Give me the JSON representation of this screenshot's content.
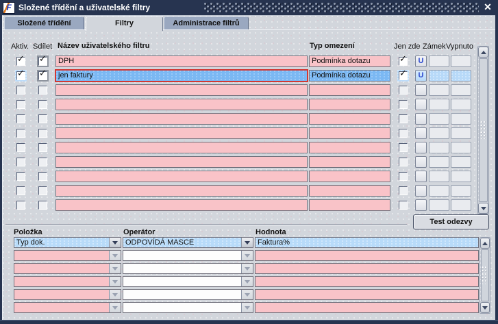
{
  "window": {
    "title": "Složené třídění a uživatelské filtry",
    "icon_letter": "F",
    "close_glyph": "✕"
  },
  "tabs": [
    {
      "label": "Složené třídění",
      "active": false
    },
    {
      "label": "Filtry",
      "active": true
    },
    {
      "label": "Administrace filtrů",
      "active": false
    }
  ],
  "filters": {
    "col_active": "Aktiv.",
    "col_shared": "Sdílet",
    "col_name": "Název uživatelského filtru",
    "col_type": "Typ omezení",
    "col_onlyhere": "Jen zde",
    "col_lock": "Zámek",
    "col_off": "Vypnuto",
    "test_button": "Test odezvy",
    "rows": [
      {
        "active": true,
        "shared": true,
        "name": "DPH",
        "type": "Podmínka dotazu",
        "only_here": true,
        "lock": "U",
        "state": "filled"
      },
      {
        "active": true,
        "shared": true,
        "name": "jen faktury",
        "type": "Podmínka dotazu",
        "only_here": true,
        "lock": "U",
        "state": "selected"
      },
      {
        "active": false,
        "shared": false,
        "name": "",
        "type": "",
        "only_here": false,
        "lock": "",
        "state": "empty"
      },
      {
        "active": false,
        "shared": false,
        "name": "",
        "type": "",
        "only_here": false,
        "lock": "",
        "state": "empty"
      },
      {
        "active": false,
        "shared": false,
        "name": "",
        "type": "",
        "only_here": false,
        "lock": "",
        "state": "empty"
      },
      {
        "active": false,
        "shared": false,
        "name": "",
        "type": "",
        "only_here": false,
        "lock": "",
        "state": "empty"
      },
      {
        "active": false,
        "shared": false,
        "name": "",
        "type": "",
        "only_here": false,
        "lock": "",
        "state": "empty"
      },
      {
        "active": false,
        "shared": false,
        "name": "",
        "type": "",
        "only_here": false,
        "lock": "",
        "state": "empty"
      },
      {
        "active": false,
        "shared": false,
        "name": "",
        "type": "",
        "only_here": false,
        "lock": "",
        "state": "empty"
      },
      {
        "active": false,
        "shared": false,
        "name": "",
        "type": "",
        "only_here": false,
        "lock": "",
        "state": "empty"
      },
      {
        "active": false,
        "shared": false,
        "name": "",
        "type": "",
        "only_here": false,
        "lock": "",
        "state": "empty"
      }
    ]
  },
  "criteria": {
    "col_item": "Položka",
    "col_operator": "Operátor",
    "col_value": "Hodnota",
    "rows": [
      {
        "item": "Typ dok.",
        "operator": "ODPOVÍDÁ MASCE",
        "value": "Faktura%",
        "state": "active"
      },
      {
        "item": "",
        "operator": "",
        "value": "",
        "state": "empty"
      },
      {
        "item": "",
        "operator": "",
        "value": "",
        "state": "empty"
      },
      {
        "item": "",
        "operator": "",
        "value": "",
        "state": "empty"
      },
      {
        "item": "",
        "operator": "",
        "value": "",
        "state": "empty"
      },
      {
        "item": "",
        "operator": "",
        "value": "",
        "state": "empty"
      }
    ]
  },
  "colors": {
    "titlebar_navy": "#273450",
    "field_pink": "#f9c3c8",
    "selection_blue": "#7bb8f3",
    "active_lightblue": "#b8dbf9",
    "tab_inactive": "#9aa8c0",
    "focus_red": "#d23732",
    "lock_blue": "#2c49cf"
  }
}
